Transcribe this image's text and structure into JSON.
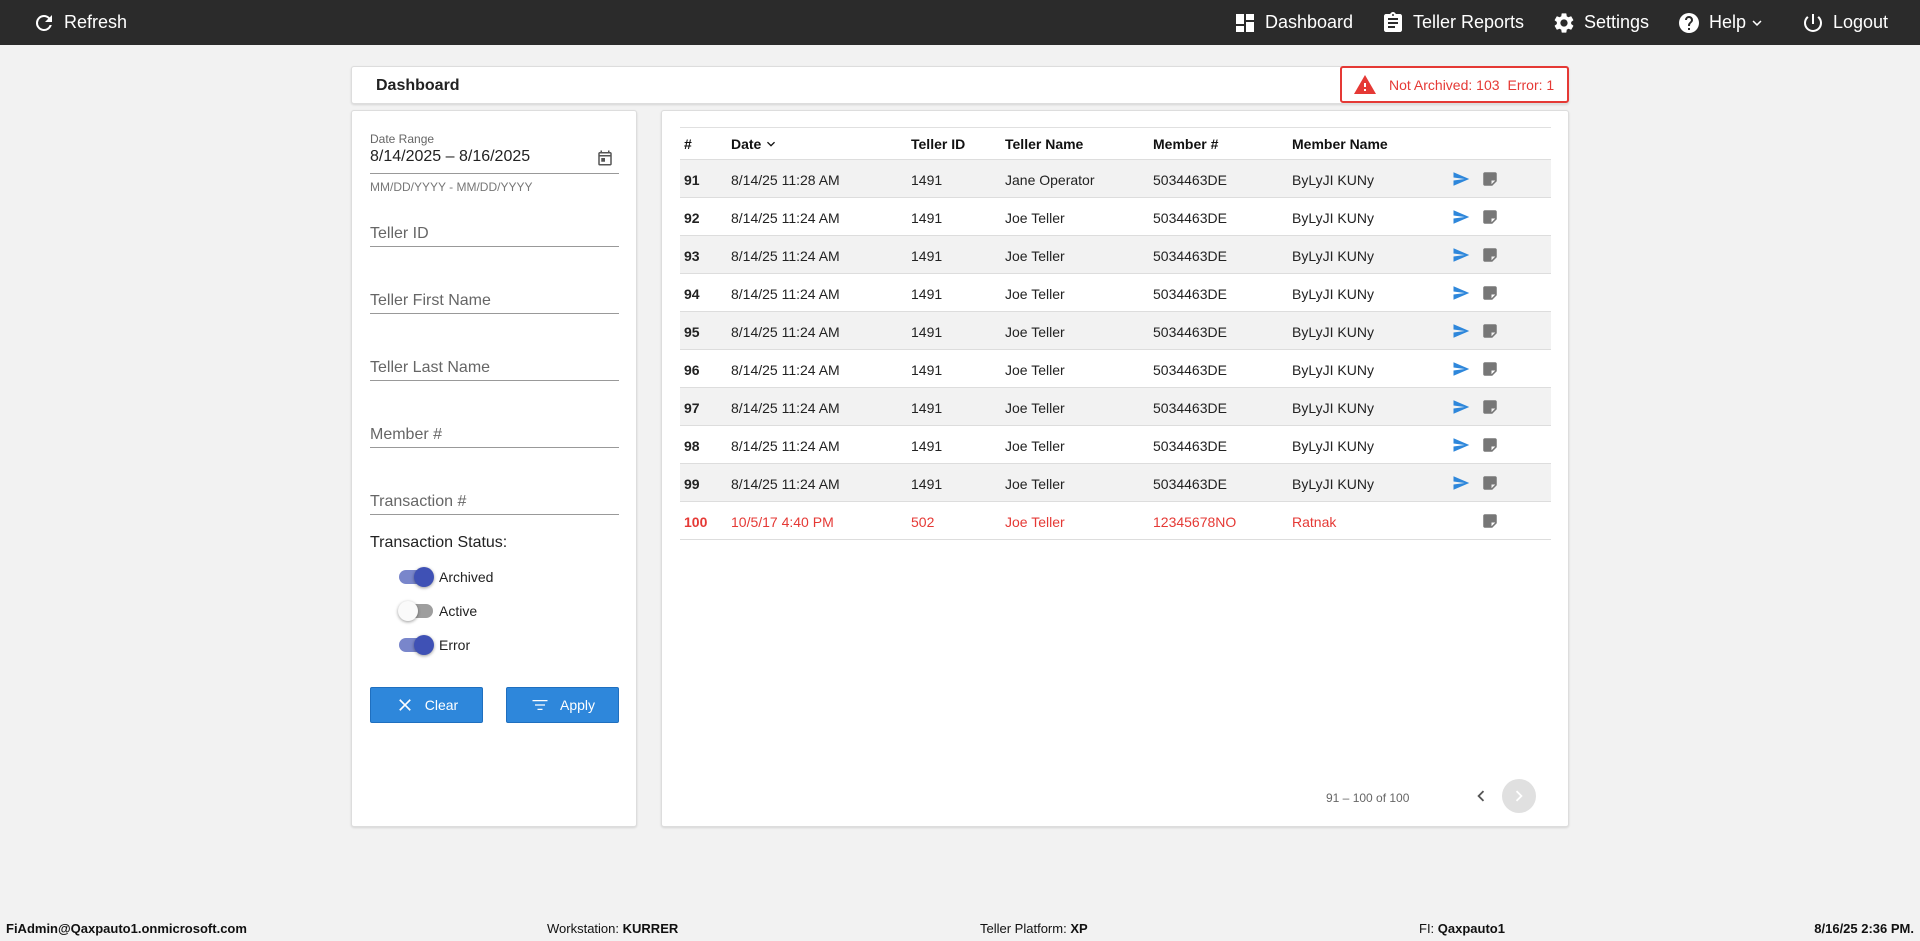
{
  "topbar": {
    "refresh": "Refresh",
    "dashboard": "Dashboard",
    "teller_reports": "Teller Reports",
    "settings": "Settings",
    "help": "Help",
    "logout": "Logout"
  },
  "dashboard": {
    "title": "Dashboard",
    "not_archived_label": "Not Archived:",
    "not_archived_count": "103",
    "error_label": "Error:",
    "error_count": "1"
  },
  "filters": {
    "date_range_label": "Date Range",
    "date_range_value": "8/14/2025 – 8/16/2025",
    "date_hint": "MM/DD/YYYY - MM/DD/YYYY",
    "teller_id_placeholder": "Teller ID",
    "teller_first_placeholder": "Teller First Name",
    "teller_last_placeholder": "Teller Last Name",
    "member_placeholder": "Member #",
    "transaction_placeholder": "Transaction #",
    "status_label": "Transaction Status:",
    "statuses": [
      {
        "label": "Archived",
        "on": true
      },
      {
        "label": "Active",
        "on": false
      },
      {
        "label": "Error",
        "on": true
      }
    ],
    "clear_label": "Clear",
    "apply_label": "Apply"
  },
  "table": {
    "headers": {
      "num": "#",
      "date": "Date",
      "teller_id": "Teller ID",
      "teller_name": "Teller Name",
      "member_num": "Member #",
      "member_name": "Member Name"
    },
    "rows": [
      {
        "num": "91",
        "date": "8/14/25 11:28 AM",
        "teller_id": "1491",
        "teller_name": "Jane Operator",
        "member_num": "5034463DE",
        "member_name": "ByLyJI KUNy",
        "error": false
      },
      {
        "num": "92",
        "date": "8/14/25 11:24 AM",
        "teller_id": "1491",
        "teller_name": "Joe Teller",
        "member_num": "5034463DE",
        "member_name": "ByLyJI KUNy",
        "error": false
      },
      {
        "num": "93",
        "date": "8/14/25 11:24 AM",
        "teller_id": "1491",
        "teller_name": "Joe Teller",
        "member_num": "5034463DE",
        "member_name": "ByLyJI KUNy",
        "error": false
      },
      {
        "num": "94",
        "date": "8/14/25 11:24 AM",
        "teller_id": "1491",
        "teller_name": "Joe Teller",
        "member_num": "5034463DE",
        "member_name": "ByLyJI KUNy",
        "error": false
      },
      {
        "num": "95",
        "date": "8/14/25 11:24 AM",
        "teller_id": "1491",
        "teller_name": "Joe Teller",
        "member_num": "5034463DE",
        "member_name": "ByLyJI KUNy",
        "error": false
      },
      {
        "num": "96",
        "date": "8/14/25 11:24 AM",
        "teller_id": "1491",
        "teller_name": "Joe Teller",
        "member_num": "5034463DE",
        "member_name": "ByLyJI KUNy",
        "error": false
      },
      {
        "num": "97",
        "date": "8/14/25 11:24 AM",
        "teller_id": "1491",
        "teller_name": "Joe Teller",
        "member_num": "5034463DE",
        "member_name": "ByLyJI KUNy",
        "error": false
      },
      {
        "num": "98",
        "date": "8/14/25 11:24 AM",
        "teller_id": "1491",
        "teller_name": "Joe Teller",
        "member_num": "5034463DE",
        "member_name": "ByLyJI KUNy",
        "error": false
      },
      {
        "num": "99",
        "date": "8/14/25 11:24 AM",
        "teller_id": "1491",
        "teller_name": "Joe Teller",
        "member_num": "5034463DE",
        "member_name": "ByLyJI KUNy",
        "error": false
      },
      {
        "num": "100",
        "date": "10/5/17 4:40 PM",
        "teller_id": "502",
        "teller_name": "Joe Teller",
        "member_num": "12345678NO",
        "member_name": "Ratnak",
        "error": true
      }
    ],
    "pager": "91 – 100 of 100"
  },
  "footer": {
    "user": "FiAdmin@Qaxpauto1.onmicrosoft.com",
    "workstation_label": "Workstation:",
    "workstation": "KURRER",
    "platform_label": "Teller Platform:",
    "platform": "XP",
    "fi_label": "FI:",
    "fi": "Qaxpauto1",
    "datetime": "8/16/25 2:36 PM."
  },
  "colors": {
    "accent": "#2e87db",
    "error": "#e53935",
    "toggle_on": "#3f51b5",
    "topbar": "#2b2b2b"
  },
  "icons": [
    "refresh-icon",
    "dashboard-icon",
    "clipboard-icon",
    "gear-icon",
    "help-icon",
    "chevron-down-icon",
    "power-icon",
    "warning-icon",
    "calendar-icon",
    "close-icon",
    "filter-icon",
    "send-icon",
    "note-icon",
    "chevron-left-icon",
    "chevron-right-icon"
  ]
}
